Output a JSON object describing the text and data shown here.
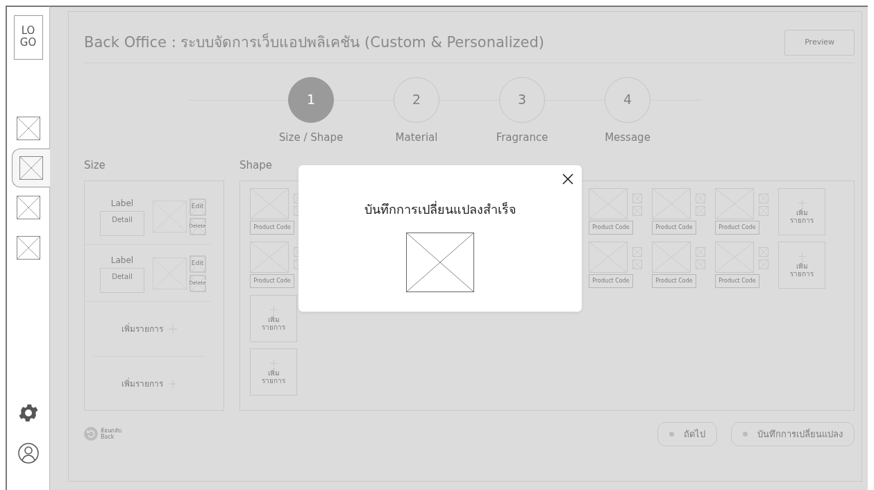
{
  "sidebar": {
    "logo": "LO\nGO",
    "nav_items": [
      {
        "selected": false
      },
      {
        "selected": true
      },
      {
        "selected": false
      },
      {
        "selected": false
      }
    ]
  },
  "header": {
    "title": "Back Office : ระบบจัดการเว็บแอปพลิเคชัน (Custom & Personalized)",
    "preview_button": "Preview"
  },
  "steps": [
    {
      "number": "1",
      "label": "Size / Shape",
      "selected": true
    },
    {
      "number": "2",
      "label": "Material",
      "selected": false
    },
    {
      "number": "3",
      "label": "Fragrance",
      "selected": false
    },
    {
      "number": "4",
      "label": "Message",
      "selected": false
    }
  ],
  "size": {
    "title": "Size",
    "items": [
      {
        "label": "Label",
        "detail": "Detail",
        "edit": "Edit",
        "delete": "Delete"
      },
      {
        "label": "Label",
        "detail": "Detail",
        "edit": "Edit",
        "delete": "Delete"
      }
    ],
    "add_rows": [
      "เพิ่มรายการ",
      "เพิ่มรายการ"
    ]
  },
  "shape": {
    "title": "Shape",
    "rows": [
      {
        "left": [
          {
            "kind": "product",
            "code": "Product Code"
          }
        ],
        "right": [
          {
            "kind": "product",
            "code": "Product Code"
          },
          {
            "kind": "product",
            "code": "Product Code"
          },
          {
            "kind": "product",
            "code": "Product Code"
          },
          {
            "kind": "add",
            "label": "เพิ่ม\nรายการ"
          }
        ]
      },
      {
        "left": [
          {
            "kind": "product",
            "code": "Product Code"
          }
        ],
        "right": [
          {
            "kind": "product",
            "code": "Product Code"
          },
          {
            "kind": "product",
            "code": "Product Code"
          },
          {
            "kind": "product",
            "code": "Product Code"
          },
          {
            "kind": "add",
            "label": "เพิ่ม\nรายการ"
          }
        ]
      },
      {
        "left": [
          {
            "kind": "add",
            "label": "เพิ่ม\nรายการ"
          }
        ],
        "right": []
      },
      {
        "left": [
          {
            "kind": "add",
            "label": "เพิ่ม\nรายการ"
          }
        ],
        "right": []
      }
    ]
  },
  "footer": {
    "back": {
      "label": "ย้อนกลับ",
      "sublabel": "Back"
    },
    "buttons": [
      "ถัดไป",
      "บันทึกการเปลี่ยนแปลง"
    ]
  },
  "modal": {
    "title": "บันทึกการเปลี่ยนแปลงสำเร็จ"
  }
}
